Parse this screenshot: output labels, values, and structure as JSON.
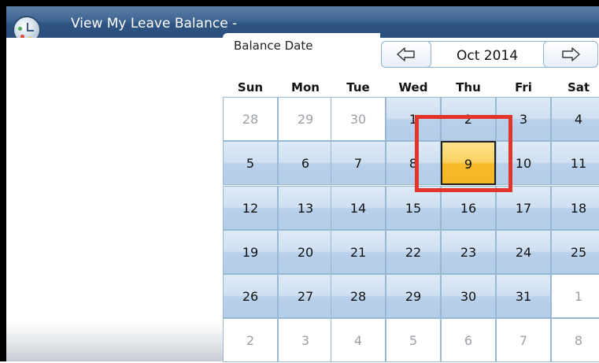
{
  "window": {
    "title": "View My Leave Balance -"
  },
  "panel": {
    "balance_label": "Balance Date"
  },
  "calendar": {
    "month_label": "Oct 2014",
    "prev_icon": "left-arrow-icon",
    "next_icon": "right-arrow-icon",
    "weekdays": [
      "Sun",
      "Mon",
      "Tue",
      "Wed",
      "Thu",
      "Fri",
      "Sat"
    ],
    "weeks": [
      [
        "28",
        "29",
        "30",
        "1",
        "2",
        "3",
        "4"
      ],
      [
        "5",
        "6",
        "7",
        "8",
        "9",
        "10",
        "11"
      ],
      [
        "12",
        "13",
        "14",
        "15",
        "16",
        "17",
        "18"
      ],
      [
        "19",
        "20",
        "21",
        "22",
        "23",
        "24",
        "25"
      ],
      [
        "26",
        "27",
        "28",
        "29",
        "30",
        "31",
        "1"
      ],
      [
        "2",
        "3",
        "4",
        "5",
        "6",
        "7",
        "8"
      ]
    ],
    "selected_day": "9"
  },
  "colors": {
    "title_bar": "#2f5583",
    "day_cell": "#c7dcf0",
    "selected_day": "#f7c23a",
    "highlight_box": "#e3342a"
  }
}
